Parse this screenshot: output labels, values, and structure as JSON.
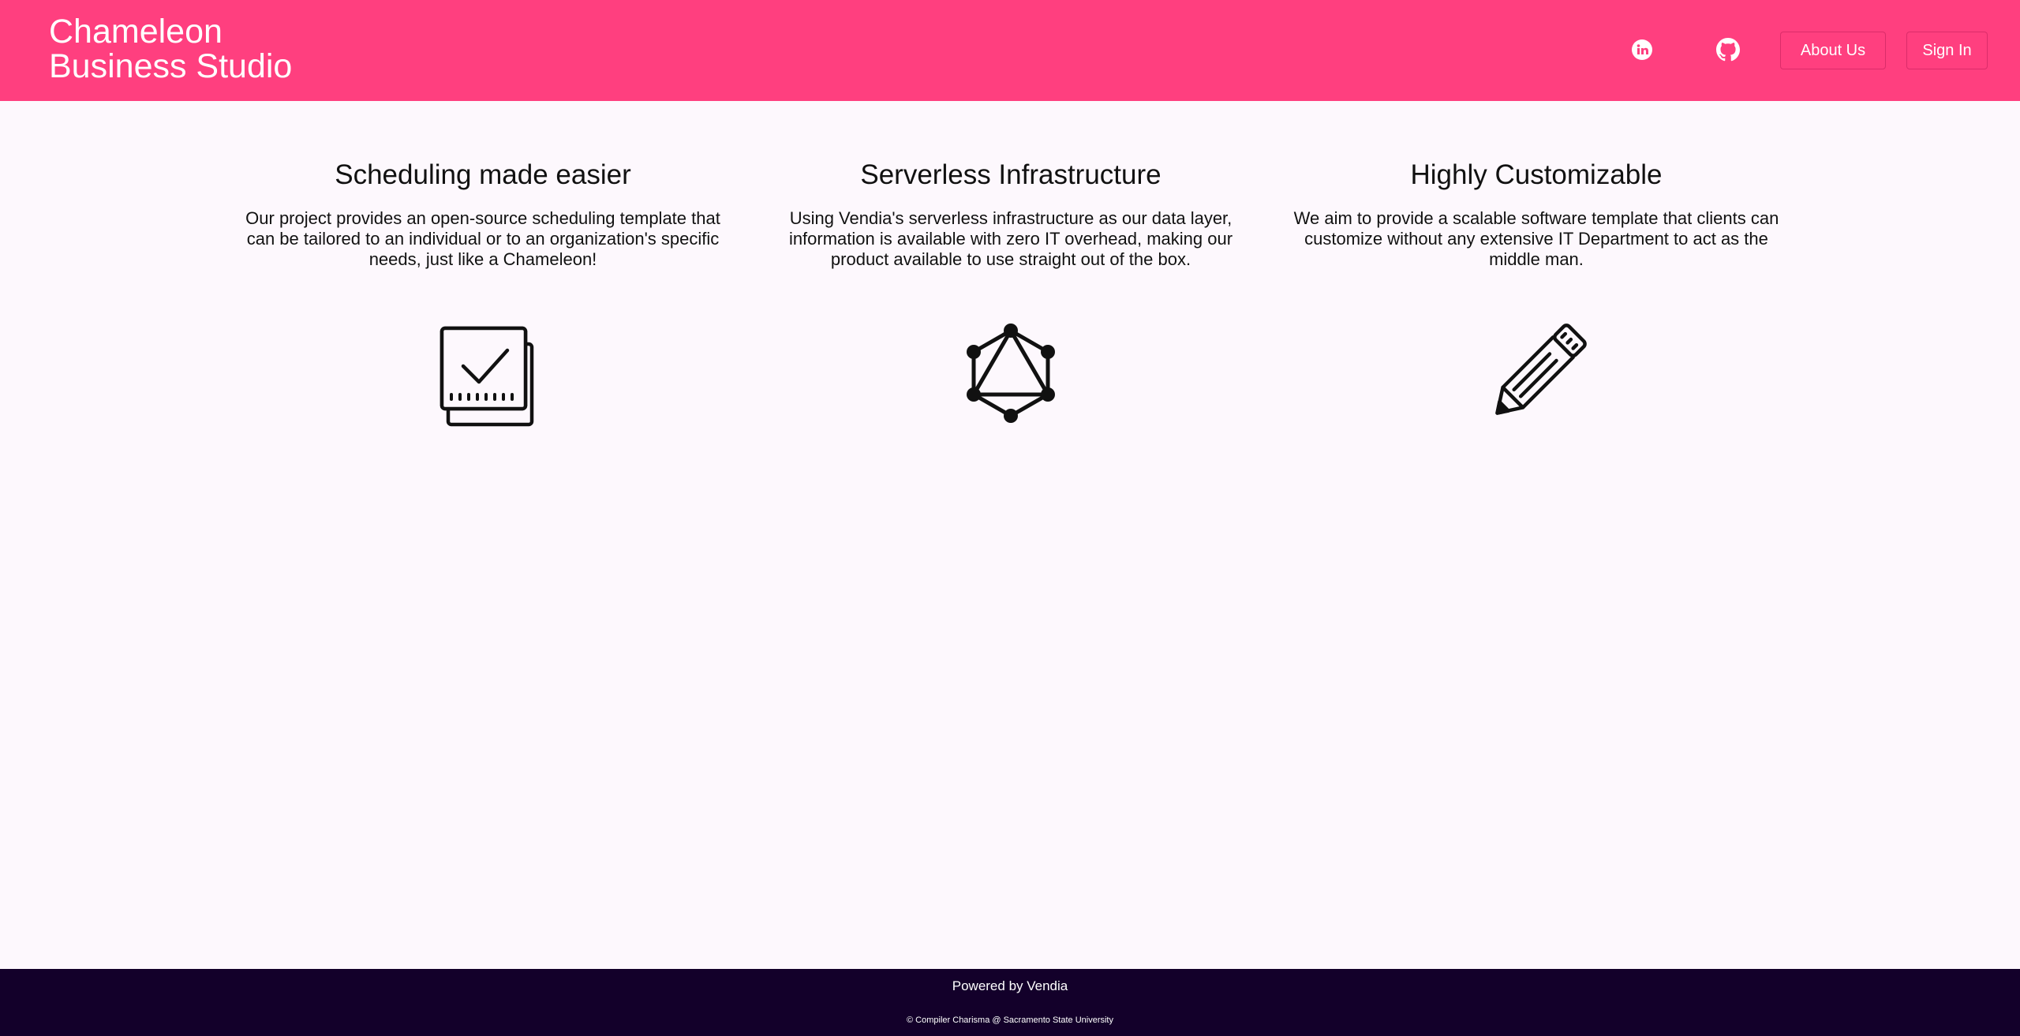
{
  "header": {
    "brand_line1": "Chameleon",
    "brand_line2": "Business Studio",
    "background_color": "#ff3f7f",
    "social": [
      {
        "name": "linkedin-icon"
      },
      {
        "name": "github-icon"
      }
    ],
    "nav": {
      "about_label": "About Us",
      "signin_label": "Sign In"
    }
  },
  "features": [
    {
      "title": "Scheduling made easier",
      "description": "Our project provides an open-source scheduling template that can be tailored to an individual or to an organization's specific needs, just like a Chameleon!",
      "icon": "calendar-check-icon"
    },
    {
      "title": "Serverless Infrastructure",
      "description": "Using Vendia's serverless infrastructure as our data layer, information is available with zero IT overhead, making our product available to use straight out of the box.",
      "icon": "graphql-icon"
    },
    {
      "title": "Highly Customizable",
      "description": "We aim to provide a scalable software template that clients can customize without any extensive IT Department to act as the middle man.",
      "icon": "pencil-icon"
    }
  ],
  "footer": {
    "powered": "Powered by Vendia",
    "copyright": "© Compiler Charisma @ Sacramento State University",
    "background_color": "#13002a"
  }
}
